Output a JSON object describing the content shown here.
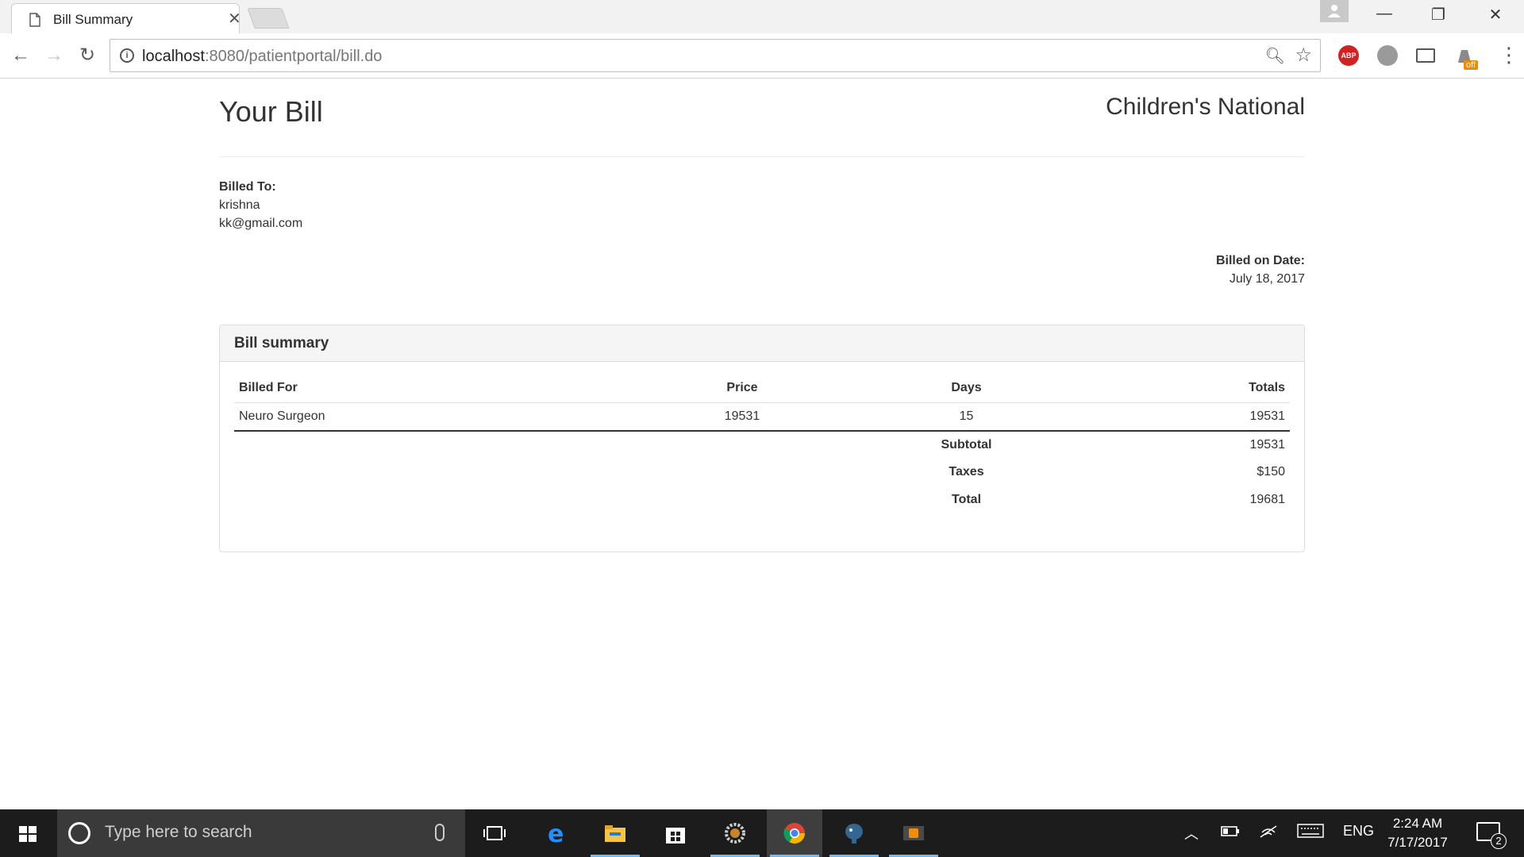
{
  "browser": {
    "tab_title": "Bill Summary",
    "url_host": "localhost",
    "url_rest": ":8080/patientportal/bill.do",
    "extension_badge": "off",
    "abp_label": "ABP"
  },
  "header": {
    "title": "Your Bill",
    "organization": "Children's National"
  },
  "billed_to": {
    "label": "Billed To:",
    "name": "krishna",
    "email": "kk@gmail.com"
  },
  "billed_on": {
    "label": "Billed on Date:",
    "date": "July 18, 2017"
  },
  "summary": {
    "heading": "Bill summary",
    "columns": [
      "Billed For",
      "Price",
      "Days",
      "Totals"
    ],
    "items": [
      {
        "billed_for": "Neuro Surgeon",
        "price": "19531",
        "days": "15",
        "total": "19531"
      }
    ],
    "subtotal_label": "Subtotal",
    "subtotal": "19531",
    "taxes_label": "Taxes",
    "taxes": "$150",
    "total_label": "Total",
    "total": "19681"
  },
  "taskbar": {
    "search_placeholder": "Type here to search",
    "language": "ENG",
    "time": "2:24 AM",
    "date": "7/17/2017",
    "notification_count": "2"
  }
}
